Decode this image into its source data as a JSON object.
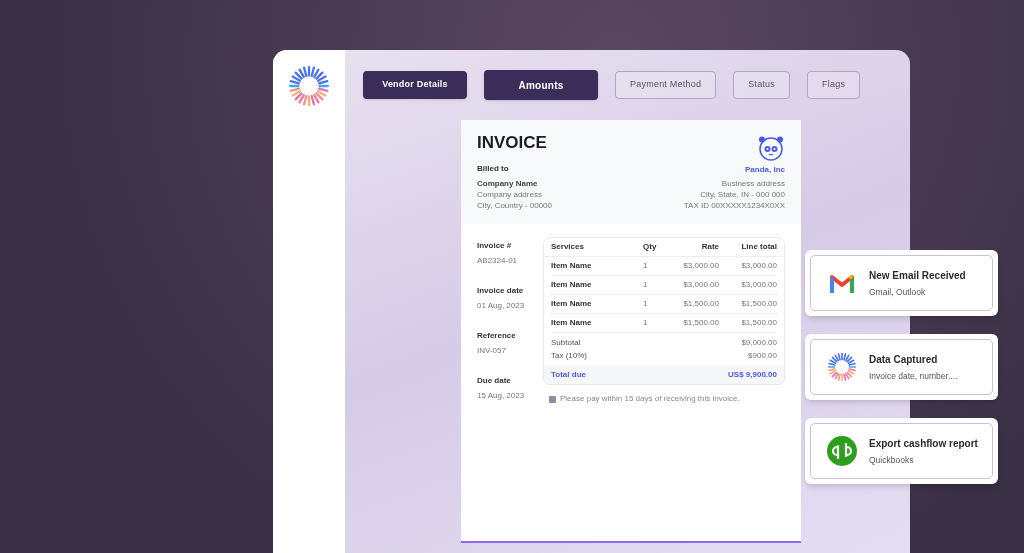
{
  "tabs": [
    {
      "label": "Vendor Details",
      "filled": true,
      "selected": false
    },
    {
      "label": "Amounts",
      "filled": true,
      "selected": true
    },
    {
      "label": "Payment Method",
      "filled": false,
      "selected": false
    },
    {
      "label": "Status",
      "filled": false,
      "selected": false
    },
    {
      "label": "Flags",
      "filled": false,
      "selected": false
    }
  ],
  "invoice": {
    "title": "INVOICE",
    "billed_to_label": "Billed to",
    "billed_to": [
      "Company Name",
      "Company address",
      "City, Country - 00000"
    ],
    "vendor_name": "Panda, Inc",
    "vendor_lines": [
      "Business address",
      "City, State, IN - 000 000",
      "TAX ID 00XXXXX1234X0XX"
    ],
    "details": [
      {
        "label": "Invoice #",
        "value": "AB2324-01"
      },
      {
        "label": "Invoice date",
        "value": "01 Aug, 2023"
      },
      {
        "label": "Reference",
        "value": "INV-057"
      },
      {
        "label": "Due date",
        "value": "15 Aug, 2023"
      }
    ],
    "columns": [
      "Services",
      "Qty",
      "Rate",
      "Line total"
    ],
    "rows": [
      [
        "Item Name",
        "1",
        "$3,000.00",
        "$3,000.00"
      ],
      [
        "Item Name",
        "1",
        "$3,000.00",
        "$3,000.00"
      ],
      [
        "Item Name",
        "1",
        "$1,500.00",
        "$1,500.00"
      ],
      [
        "Item Name",
        "1",
        "$1,500.00",
        "$1,500.00"
      ]
    ],
    "summary": [
      {
        "label": "Subtotal",
        "value": "$9,000.00"
      },
      {
        "label": "Tax (10%)",
        "value": "$900.00"
      }
    ],
    "total": {
      "label": "Total due",
      "value": "US$ 9,900.00"
    },
    "note": "Please pay within 15 days of receiving this invoice."
  },
  "notifications": [
    {
      "kind": "mail",
      "title": "New Email Received",
      "subtitle": "Gmail, Outlook"
    },
    {
      "kind": "burst",
      "title": "Data Captured",
      "subtitle": "Invoice date, number...."
    },
    {
      "kind": "qb",
      "title": "Export cashflow report",
      "subtitle": "Quickbooks"
    }
  ]
}
